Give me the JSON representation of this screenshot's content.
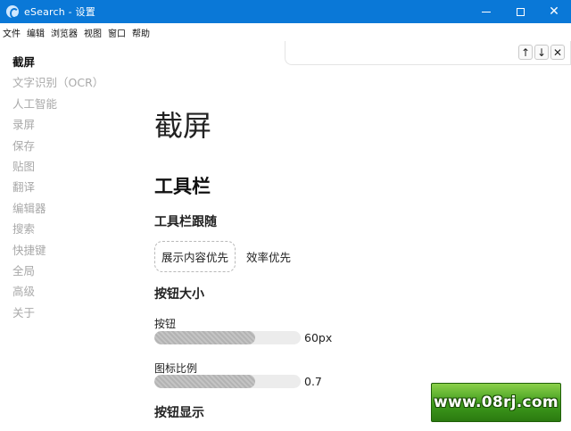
{
  "window": {
    "title": "eSearch - 设置",
    "icon": "esearch-logo-icon",
    "controls": {
      "minimize": "minimize-icon",
      "maximize": "maximize-icon",
      "close": "✕"
    }
  },
  "menubar": {
    "items": [
      "文件",
      "编辑",
      "浏览器",
      "视图",
      "窗口",
      "帮助"
    ]
  },
  "nav": {
    "up": "↑",
    "down": "↓",
    "close": "✕"
  },
  "sidebar": {
    "items": [
      {
        "label": "截屏",
        "active": true
      },
      {
        "label": "文字识别（OCR）",
        "active": false
      },
      {
        "label": "人工智能",
        "active": false
      },
      {
        "label": "录屏",
        "active": false
      },
      {
        "label": "保存",
        "active": false
      },
      {
        "label": "贴图",
        "active": false
      },
      {
        "label": "翻译",
        "active": false
      },
      {
        "label": "编辑器",
        "active": false
      },
      {
        "label": "搜索",
        "active": false
      },
      {
        "label": "快捷键",
        "active": false
      },
      {
        "label": "全局",
        "active": false
      },
      {
        "label": "高级",
        "active": false
      },
      {
        "label": "关于",
        "active": false
      }
    ]
  },
  "main": {
    "page_title": "截屏",
    "section_title": "工具栏",
    "toolbar_follow": {
      "heading": "工具栏跟随",
      "options": [
        "展示内容优先",
        "效率优先"
      ],
      "selected": "展示内容优先"
    },
    "button_size": {
      "heading": "按钮大小",
      "sliders": [
        {
          "label": "按钮",
          "value": "60px",
          "fill_fraction": 0.69
        },
        {
          "label": "图标比例",
          "value": "0.7",
          "fill_fraction": 0.69
        }
      ]
    },
    "button_display_heading": "按钮显示"
  },
  "watermark": {
    "text": "www.08rj.com"
  },
  "colors": {
    "titlebar": "#0a78d7",
    "sidebar_inactive": "#a9a9a9",
    "slider_track": "#ececec",
    "slider_fill": "#b3b3b3"
  }
}
